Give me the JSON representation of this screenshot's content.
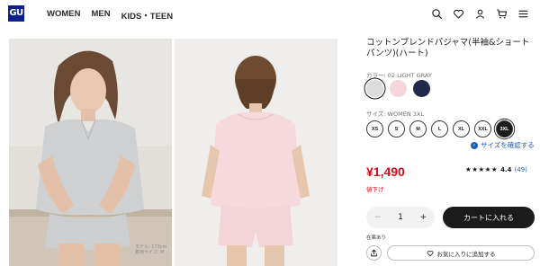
{
  "header": {
    "logo_text": "GU",
    "logo_color": "#0b1f8f",
    "nav": [
      "WOMEN",
      "MEN",
      "KIDS・TEEN"
    ],
    "icons": [
      "search-icon",
      "heart-icon",
      "user-icon",
      "cart-icon",
      "menu-icon"
    ]
  },
  "gallery": {
    "watermark_line1": "モデル: 173cm",
    "watermark_line2": "着用サイズ: M"
  },
  "product": {
    "title": "コットンブレンドパジャマ(半袖&ショートパンツ)(ハート)",
    "color_label": "カラー: 02 LIGHT GRAY",
    "colors": [
      {
        "name": "LIGHT GRAY",
        "hex": "#dcdcdc",
        "selected": true
      },
      {
        "name": "PINK",
        "hex": "#f5d6dc",
        "selected": false
      },
      {
        "name": "NAVY",
        "hex": "#1f2a4a",
        "selected": false
      }
    ],
    "size_label": "サイズ: WOMEN 3XL",
    "sizes": [
      {
        "label": "XS",
        "selected": false
      },
      {
        "label": "S",
        "selected": false
      },
      {
        "label": "M",
        "selected": false
      },
      {
        "label": "L",
        "selected": false
      },
      {
        "label": "XL",
        "selected": false
      },
      {
        "label": "XXL",
        "selected": false
      },
      {
        "label": "3XL",
        "selected": true
      }
    ],
    "size_guide": "サイズを確認する",
    "price": "¥1,490",
    "price_color": "#d10b1c",
    "discount": "値下げ",
    "stars": "★★★★★",
    "rating": "4.4",
    "review_count": "(49)",
    "quantity": "1",
    "qty_minus": "−",
    "qty_plus": "+",
    "add_to_cart": "カートに入れる",
    "stock": "在庫あり",
    "favorite": "お気に入りに追加する"
  }
}
